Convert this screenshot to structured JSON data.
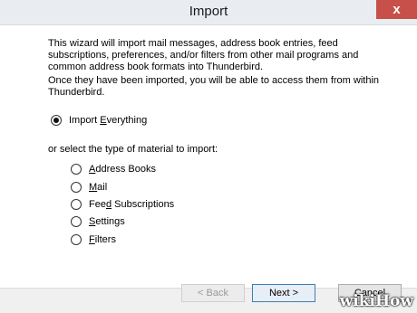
{
  "window": {
    "title": "Import"
  },
  "intro_text": "This wizard will import mail messages, address book entries, feed subscriptions, preferences, and/or filters from other mail programs and common address book formats into Thunderbird.",
  "note_text": "Once they have been imported, you will be able to access them from within Thunderbird.",
  "import_everything": {
    "label_pre": "Import ",
    "label_u": "E",
    "label_post": "verything",
    "checked": true
  },
  "or_label": "or select the type of material to import:",
  "options": [
    {
      "pre": "",
      "u": "A",
      "post": "ddress Books"
    },
    {
      "pre": "",
      "u": "M",
      "post": "ail"
    },
    {
      "pre": "Fee",
      "u": "d",
      "post": " Subscriptions"
    },
    {
      "pre": "",
      "u": "S",
      "post": "ettings"
    },
    {
      "pre": "",
      "u": "F",
      "post": "ilters"
    }
  ],
  "buttons": {
    "back": "< Back",
    "next": "Next >",
    "cancel": "Cancel"
  },
  "watermark": "wikiHow",
  "close_glyph": "x"
}
